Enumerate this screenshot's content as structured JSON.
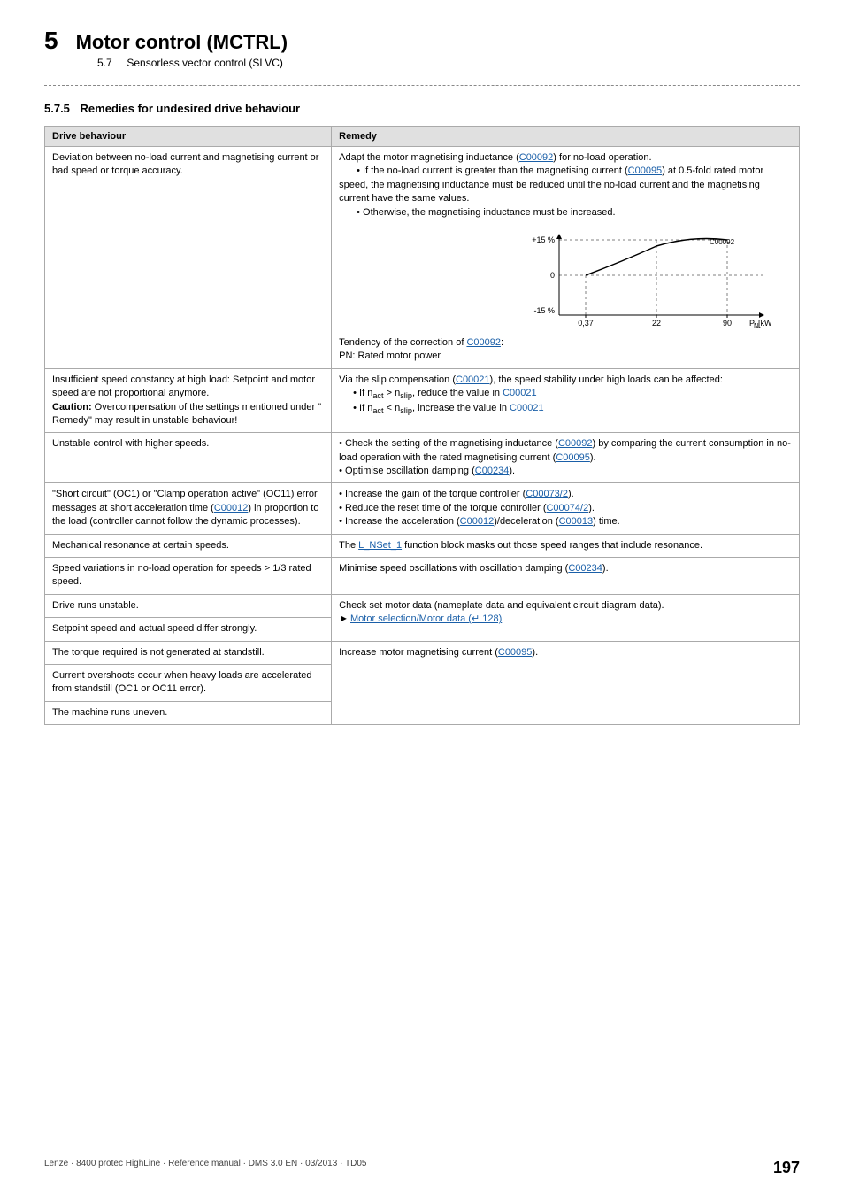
{
  "header": {
    "chapter_num": "5",
    "chapter_title": "Motor control (MCTRL)",
    "section": "5.7",
    "section_title": "Sensorless vector control (SLVC)"
  },
  "section": {
    "number": "5.7.5",
    "title": "Remedies for undesired drive behaviour"
  },
  "table": {
    "col1_header": "Drive behaviour",
    "col2_header": "Remedy",
    "rows": [
      {
        "behaviour": "Deviation between no-load current and magnetising current or bad speed or torque accuracy.",
        "remedy_html": "adapt_motor_magnetising"
      },
      {
        "behaviour": "Insufficient speed constancy at high load: Setpoint and motor speed are not proportional anymore.\nCaution: Overcompensation of the settings mentioned under \"Remedy\" may result in unstable behaviour!",
        "remedy_html": "slip_compensation"
      },
      {
        "behaviour": "Unstable control with higher speeds.",
        "remedy_html": "unstable_control"
      },
      {
        "behaviour": "\"Short circuit\" (OC1) or \"Clamp operation active\" (OC11) error messages at short acceleration time (C00012) in proportion to the load (controller cannot follow the dynamic processes).",
        "remedy_html": "short_circuit"
      },
      {
        "behaviour": "Mechanical resonance at certain speeds.",
        "remedy_html": "mechanical_resonance"
      },
      {
        "behaviour": "Speed variations in no-load operation for speeds > 1/3 rated speed.",
        "remedy_html": "speed_variations"
      },
      {
        "behaviour": "Drive runs unstable.",
        "remedy_html": "drive_unstable",
        "rowspan": 2
      },
      {
        "behaviour": "Setpoint speed and actual speed differ strongly.",
        "remedy_html": null
      },
      {
        "behaviour": "The torque required is not generated at standstill.",
        "remedy_html": "torque_standstill"
      },
      {
        "behaviour": "Current overshoots occur when heavy loads are accelerated from standstill (OC1 or OC11 error).",
        "remedy_html": null
      },
      {
        "behaviour": "The machine runs uneven.",
        "remedy_html": null
      }
    ]
  },
  "chart": {
    "plus15": "+15 %",
    "zero": "0",
    "minus15": "-15 %",
    "x1": "0,37",
    "x2": "22",
    "x3": "90",
    "xlabel": "Pₙ [kW]",
    "label_c00092": "C00092",
    "caption": "PN: Rated motor power"
  },
  "footer": {
    "left": "Lenze · 8400 protec HighLine · Reference manual · DMS 3.0 EN · 03/2013 · TD05",
    "right": "197"
  }
}
